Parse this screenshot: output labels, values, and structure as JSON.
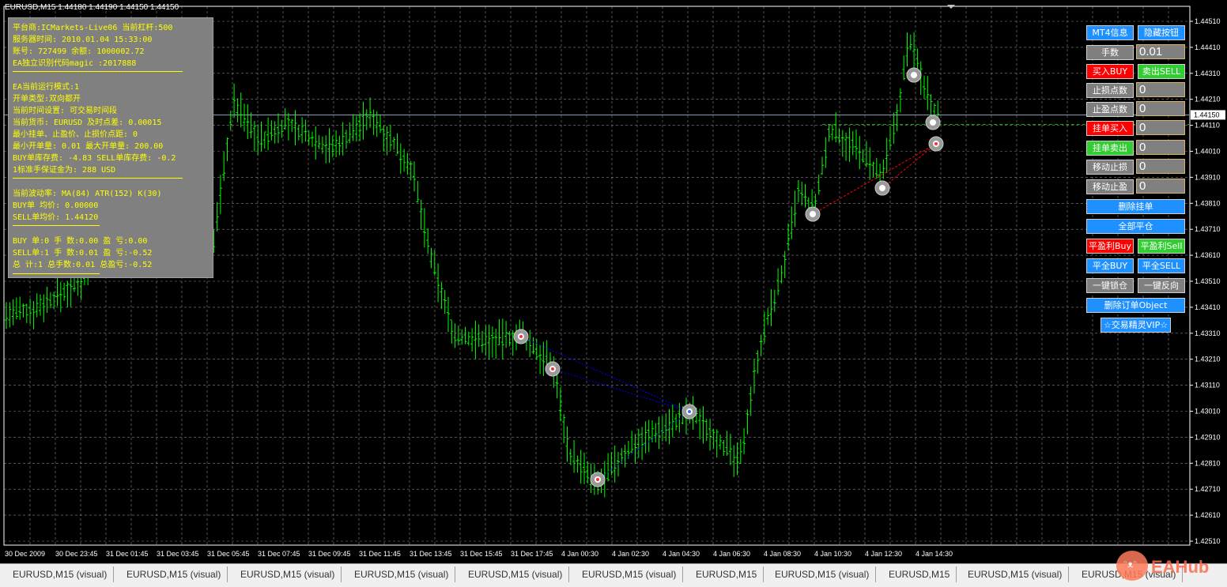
{
  "chart": {
    "title": "EURUSD,M15  1.44180 1.44190 1.44150 1.44150",
    "current_price": "1.44150",
    "price_ticks": [
      "1.44510",
      "1.44410",
      "1.44310",
      "1.44210",
      "1.44110",
      "1.44010",
      "1.43910",
      "1.43810",
      "1.43710",
      "1.43610",
      "1.43510",
      "1.43410",
      "1.43310",
      "1.43210",
      "1.43110",
      "1.43010",
      "1.42910",
      "1.42810",
      "1.42710",
      "1.42610",
      "1.42510"
    ],
    "time_ticks": [
      "30 Dec 2009",
      "30 Dec 23:45",
      "31 Dec 01:45",
      "31 Dec 03:45",
      "31 Dec 05:45",
      "31 Dec 07:45",
      "31 Dec 09:45",
      "31 Dec 11:45",
      "31 Dec 13:45",
      "31 Dec 15:45",
      "31 Dec 17:45",
      "4 Jan 00:30",
      "4 Jan 02:30",
      "4 Jan 04:30",
      "4 Jan 06:30",
      "4 Jan 08:30",
      "4 Jan 10:30",
      "4 Jan 12:30",
      "4 Jan 14:30"
    ],
    "colors": {
      "bars": "#00ff00",
      "grid": "#c0c0c0",
      "axis": "#ffffff",
      "buy_line": "#0000ff",
      "sell_line": "#ff0000"
    }
  },
  "info_panel": {
    "lines": [
      "平台商:ICMarkets-Live06 当前杠杆:500",
      "服务器时间: 2010.01.04 15:33:00",
      "账号: 727499  余额: 1000002.72",
      "EA独立识别代码magic :2017888",
      "EA当前运行模式:1",
      "开单类型:双向都开",
      "当前时间设置: 可交易时间段",
      "当前货币: EURUSD  及时点差: 0.00015",
      "最小挂单、止盈价、止损价点距: 0",
      "最小开单量: 0.01  最大开单量: 200.00",
      "BUY单库存费: -4.83  SELL单库存费: -0.2",
      "1标准手保证金为: 288  USD",
      "当前波动率: MA(84) ATR(152) K(30)",
      "BUY单 均价: 0.00000",
      "SELL单均价: 1.44120",
      "BUY 单:0  手  数:0.00  盈  亏:0.00",
      "SELL单:1  手  数:0.01  盈  亏:-0.52",
      "总  计:1  总手数:0.01  总盈亏:-0.52"
    ]
  },
  "buttons": {
    "mt4_info": "MT4信息",
    "hide_buttons": "隐藏按钮",
    "lots_label": "手数",
    "lots_value": "0.01",
    "buy": "买入BUY",
    "sell": "卖出SELL",
    "stop_loss_label": "止损点数",
    "stop_loss_value": "0",
    "take_profit_label": "止盈点数",
    "take_profit_value": "0",
    "pending_buy": "挂单买入",
    "pending_buy_value": "0",
    "pending_sell": "挂单卖出",
    "pending_sell_value": "0",
    "trailing_stop": "移动止损",
    "trailing_stop_value": "0",
    "trailing_profit": "移动止盈",
    "trailing_profit_value": "0",
    "delete_pending": "删除挂单",
    "close_all": "全部平仓",
    "close_profit_buy": "平盈利Buy",
    "close_profit_sell": "平盈利Sell",
    "close_all_buy": "平全BUY",
    "close_all_sell": "平全SELL",
    "one_click_lock": "一键锁仓",
    "one_click_reverse": "一键反向",
    "delete_order_objects": "删除订单Object",
    "vip": "☆交易精灵VIP☆"
  },
  "tabs": [
    "EURUSD,M15 (visual)",
    "EURUSD,M15 (visual)",
    "EURUSD,M15 (visual)",
    "EURUSD,M15 (visual)",
    "EURUSD,M15 (visual)",
    "EURUSD,M15 (visual)",
    "EURUSD,M15",
    "EURUSD,M15 (visual)",
    "EURUSD,M15",
    "EURUSD,M15 (visual)",
    "EURUSD,M15 (visual)"
  ],
  "watermark": {
    "text": "EAHub"
  }
}
